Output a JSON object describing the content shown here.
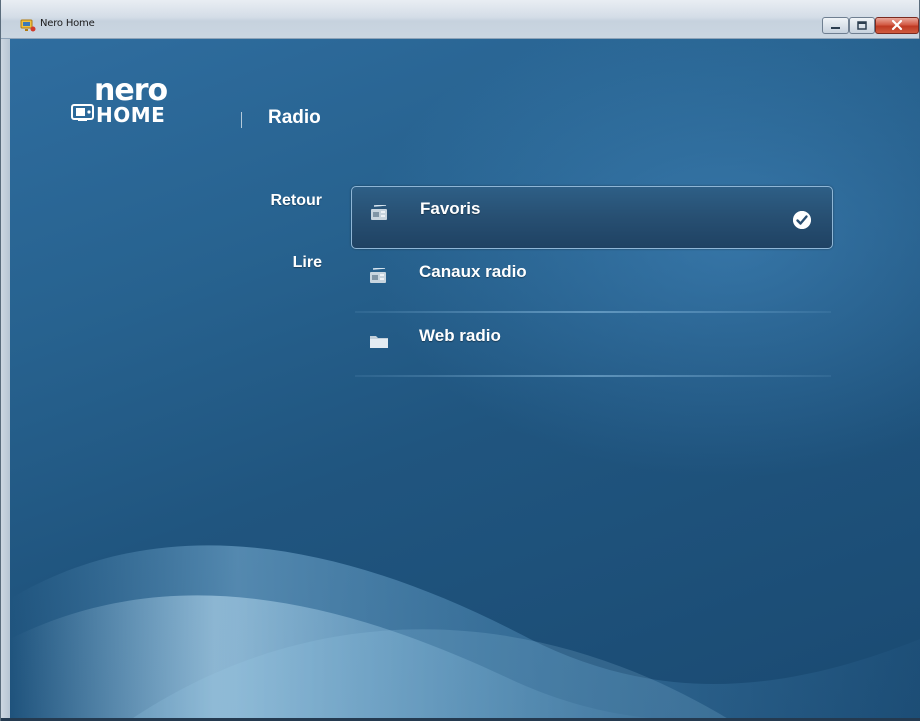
{
  "window": {
    "title": "Nero Home",
    "icon": "nero-home-app-icon",
    "controls": [
      "minimize-icon",
      "maximize-icon",
      "close-icon"
    ]
  },
  "header": {
    "logo_line1": "nero",
    "logo_line2": "HOME",
    "logo_icon": "tv-icon",
    "section": "Radio"
  },
  "left_actions": [
    {
      "label": "Retour"
    },
    {
      "label": "Lire"
    }
  ],
  "menu": {
    "items": [
      {
        "label": "Favoris",
        "icon": "radio-icon",
        "selected": true,
        "checked": true
      },
      {
        "label": "Canaux radio",
        "icon": "radio-icon",
        "selected": false
      },
      {
        "label": "Web radio",
        "icon": "folder-icon",
        "selected": false
      }
    ]
  },
  "colors": {
    "background": "#20557f",
    "accent": "#8fb6d6",
    "close_button": "#c9452e"
  }
}
